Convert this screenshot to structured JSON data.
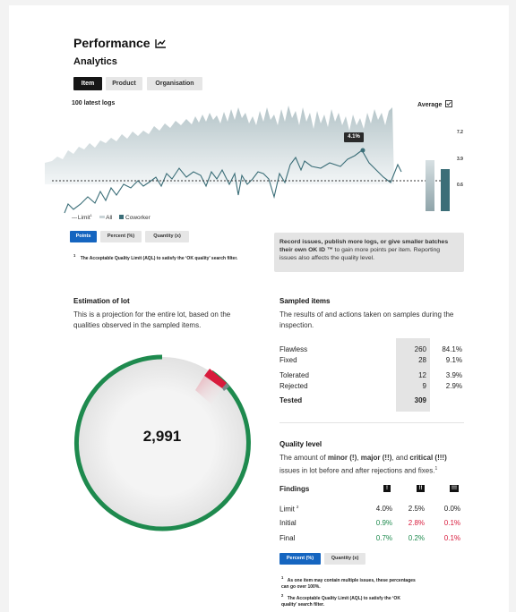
{
  "header": {
    "title": "Performance",
    "subtitle": "Analytics"
  },
  "tabs": [
    {
      "label": "Item",
      "active": true
    },
    {
      "label": "Product",
      "active": false
    },
    {
      "label": "Organisation",
      "active": false
    }
  ],
  "chart": {
    "title": "100 latest logs",
    "average_label": "Average",
    "y_ticks": [
      "7.2",
      "3.9",
      "0.6"
    ],
    "tooltip": "4.1%",
    "legend": {
      "limit": "Limit",
      "limit_sup": "1",
      "all": "All",
      "coworker": "Coworker"
    }
  },
  "chart_data": {
    "type": "area",
    "title": "100 latest logs",
    "series": [
      {
        "name": "All",
        "kind": "area"
      },
      {
        "name": "Coworker",
        "kind": "line"
      }
    ],
    "limit_line": true,
    "average_bars": [
      {
        "name": "All"
      },
      {
        "name": "Coworker"
      }
    ],
    "highlight_value": "4.1%"
  },
  "unit_buttons_top": [
    {
      "label": "Points",
      "active": true
    },
    {
      "label": "Percent (%)",
      "active": false
    },
    {
      "label": "Quantity (x)",
      "active": false
    }
  ],
  "aql_note_top": {
    "sup": "1",
    "text": "The Acceptable Quality Limit (AQL) to satisfy the ‘OK quality’ search filter."
  },
  "info_box": {
    "bold": "Record issues, publish more logs, or give smaller batches their own OK ID ™",
    "text": " to gain more points per item. Reporting issues also affects the quality level."
  },
  "estimation": {
    "title": "Estimation of lot",
    "desc": "This is a projection for the entire lot, based on the qualities observed in the sampled items.",
    "total": "2,991"
  },
  "sampled": {
    "title": "Sampled items",
    "desc": "The results of and actions taken on samples during the inspection.",
    "rows": [
      {
        "label": "Flawless",
        "count": "260",
        "pct": "84.1%"
      },
      {
        "label": "Fixed",
        "count": "28",
        "pct": "9.1%"
      },
      {
        "label": "Tolerated",
        "count": "12",
        "pct": "3.9%"
      },
      {
        "label": "Rejected",
        "count": "9",
        "pct": "2.9%"
      }
    ],
    "total": {
      "label": "Tested",
      "count": "309"
    }
  },
  "quality": {
    "title": "Quality level",
    "desc_pre": "The amount of ",
    "minor": "minor (!)",
    "sep1": ", ",
    "major": "major (!!)",
    "sep2": ", and ",
    "critical": "critical (!!!)",
    "desc_post": " issues in lot before and after rejections and fixes.",
    "desc_sup": "1",
    "findings_label": "Findings",
    "severity_icons": [
      "!",
      "!!",
      "!!!"
    ],
    "rows": [
      {
        "label": "Limit",
        "sup": "2",
        "values": [
          "4.0%",
          "2.5%",
          "0.0%"
        ]
      },
      {
        "label": "Initial",
        "values": [
          "0.9%",
          "2.8%",
          "0.1%"
        ]
      },
      {
        "label": "Final",
        "values": [
          "0.7%",
          "0.2%",
          "0.1%"
        ]
      }
    ]
  },
  "unit_buttons_bottom": [
    {
      "label": "Percent (%)",
      "active": true
    },
    {
      "label": "Quantity (x)",
      "active": false
    }
  ],
  "footnotes": [
    {
      "sup": "1",
      "text": "As one item may contain multiple issues, these percentages can go over 100%."
    },
    {
      "sup": "2",
      "text": "The Acceptable Quality Limit (AQL) to satisfy the ‘OK quality’ search filter."
    }
  ],
  "colors": {
    "accent": "#1565c0",
    "green": "#1e8a4e",
    "red": "#d81b3c",
    "teal": "#3b6e78"
  }
}
